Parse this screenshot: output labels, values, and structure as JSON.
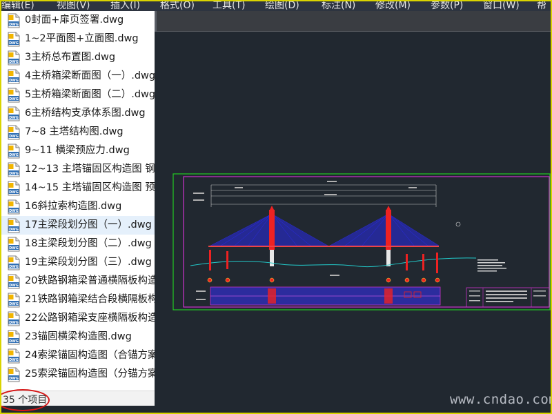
{
  "menubar": {
    "items": [
      "编辑(E)",
      "视图(V)",
      "插入(I)",
      "格式(O)",
      "工具(T)",
      "绘图(D)",
      "标注(N)",
      "修改(M)",
      "参数(P)",
      "窗口(W)",
      "帮"
    ]
  },
  "file_list": {
    "icon_label": "DWG",
    "items": [
      "0封面+扉页签署.dwg",
      "1~2平面图+立面图.dwg",
      "3主桥总布置图.dwg",
      "4主桥箱梁断面图（一）.dwg",
      "5主桥箱梁断面图（二）.dwg",
      "6主桥结构支承体系图.dwg",
      "7~8 主塔结构图.dwg",
      "9~11 横梁预应力.dwg",
      "12~13 主塔锚固区构造图 钢",
      "14~15 主塔锚固区构造图 预",
      "16斜拉索构造图.dwg",
      "17主梁段划分图（一）.dwg",
      "18主梁段划分图（二）.dwg",
      "19主梁段划分图（三）.dwg",
      "20铁路钢箱梁普通横隔板构造",
      "21铁路钢箱梁结合段横隔板构",
      "22公路钢箱梁支座横隔板构造",
      "23锚固横梁构造图.dwg",
      "24索梁锚固构造图（合锚方案",
      "25索梁锚固构造图（分锚方案"
    ],
    "selected_index": 11
  },
  "status": {
    "item_count": "35 个项目"
  },
  "watermark": "www.cndao.com",
  "colors": {
    "canvas_bg": "#212830",
    "frame": "#d9d400",
    "selection": "#e5f0fb",
    "cable_blue": "#2a2ae8",
    "sheet_magenta": "#cc33cc",
    "border_green": "#22cc22",
    "annotation_red": "#d61818"
  }
}
